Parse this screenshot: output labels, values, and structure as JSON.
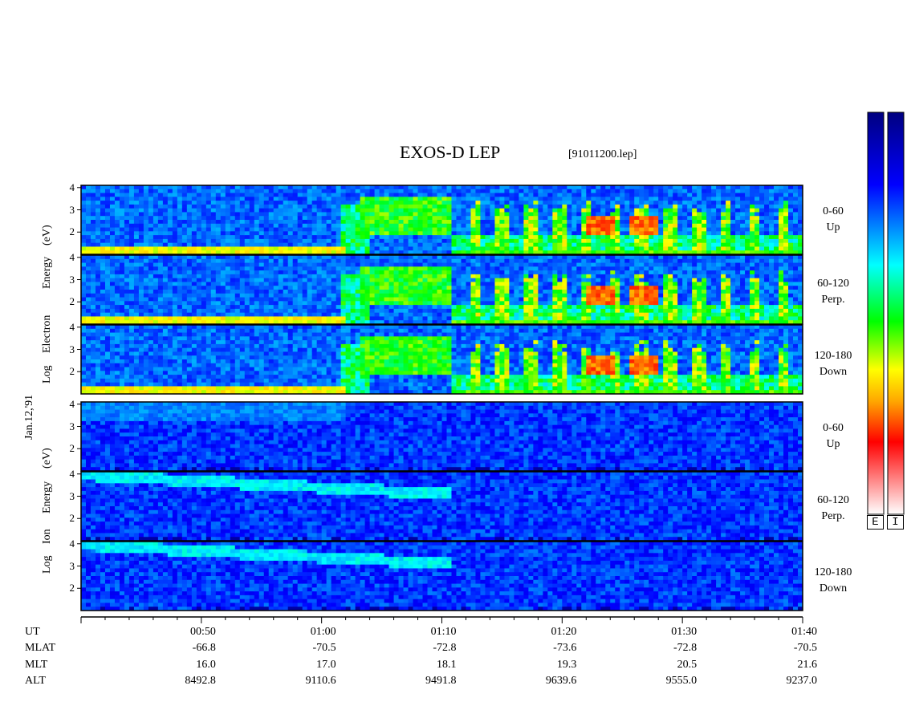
{
  "chart_data": {
    "type": "heatmap",
    "title": "EXOS-D LEP",
    "file_label": "[91011200.lep]",
    "date_label": "Jan.12,'91",
    "groups": [
      {
        "name": "Electron",
        "ylabel_parts": [
          "Log",
          "Electron",
          "Energy",
          "(eV)"
        ],
        "panels": [
          {
            "pitch": "0-60",
            "direction": "Up"
          },
          {
            "pitch": "60-120",
            "direction": "Perp."
          },
          {
            "pitch": "120-180",
            "direction": "Down"
          }
        ]
      },
      {
        "name": "Ion",
        "ylabel_parts": [
          "Log",
          "Ion",
          "Energy",
          "(eV)"
        ],
        "panels": [
          {
            "pitch": "0-60",
            "direction": "Up"
          },
          {
            "pitch": "60-120",
            "direction": "Perp."
          },
          {
            "pitch": "120-180",
            "direction": "Down"
          }
        ]
      }
    ],
    "y_ticks": [
      "4",
      "3",
      "2"
    ],
    "ylim": [
      1,
      4.1
    ],
    "x_range_minutes": [
      40,
      100
    ],
    "x_ticks_minutes": [
      50,
      60,
      70,
      80,
      90,
      100
    ],
    "orbit_rows": {
      "labels": [
        "UT",
        "MLAT",
        "MLT",
        "ALT"
      ],
      "UT": [
        "00:50",
        "01:00",
        "01:10",
        "01:20",
        "01:30",
        "01:40"
      ],
      "MLAT": [
        "-66.8",
        "-70.5",
        "-72.8",
        "-73.6",
        "-72.8",
        "-70.5"
      ],
      "MLT": [
        "16.0",
        "17.0",
        "18.1",
        "19.3",
        "20.5",
        "21.6"
      ],
      "ALT": [
        "8492.8",
        "9110.6",
        "9491.8",
        "9639.6",
        "9555.0",
        "9237.0"
      ]
    },
    "colorbars": [
      "E",
      "I"
    ],
    "colormap": [
      "#ffffff",
      "#ff0000",
      "#ffa500",
      "#ffff00",
      "#00ff00",
      "#00ffff",
      "#0000ff",
      "#000080"
    ]
  }
}
